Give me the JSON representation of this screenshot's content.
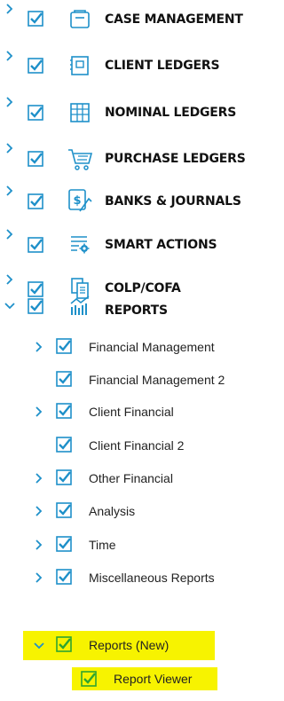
{
  "colors": {
    "accent": "#1e90c9",
    "highlight": "#f7f300",
    "text": "#111111"
  },
  "top_items": [
    {
      "label": "CASE MANAGEMENT",
      "icon": "folder-icon",
      "expanded": false
    },
    {
      "label": "CLIENT LEDGERS",
      "icon": "ledger-book-icon",
      "expanded": false
    },
    {
      "label": "NOMINAL LEDGERS",
      "icon": "grid-ledger-icon",
      "expanded": false
    },
    {
      "label": "PURCHASE LEDGERS",
      "icon": "shopping-cart-icon",
      "expanded": false
    },
    {
      "label": "BANKS & JOURNALS",
      "icon": "bank-dollar-icon",
      "expanded": false
    },
    {
      "label": "SMART ACTIONS",
      "icon": "list-gear-icon",
      "expanded": false
    },
    {
      "label": "COLP/COFA",
      "icon": "documents-icon",
      "expanded": false
    },
    {
      "label": "REPORTS",
      "icon": "chart-bars-icon",
      "expanded": true
    }
  ],
  "report_items": [
    {
      "label": "Financial Management",
      "has_children": true
    },
    {
      "label": "Financial Management 2",
      "has_children": false
    },
    {
      "label": "Client Financial",
      "has_children": true
    },
    {
      "label": "Client Financial 2",
      "has_children": false
    },
    {
      "label": "Other Financial",
      "has_children": true
    },
    {
      "label": "Analysis",
      "has_children": true
    },
    {
      "label": "Time",
      "has_children": true
    },
    {
      "label": "Miscellaneous Reports",
      "has_children": true
    },
    {
      "label": "Reports (New)",
      "has_children": true,
      "expanded": true,
      "highlighted": true
    }
  ],
  "report_new_children": [
    {
      "label": "Report Viewer",
      "highlighted": true
    }
  ]
}
